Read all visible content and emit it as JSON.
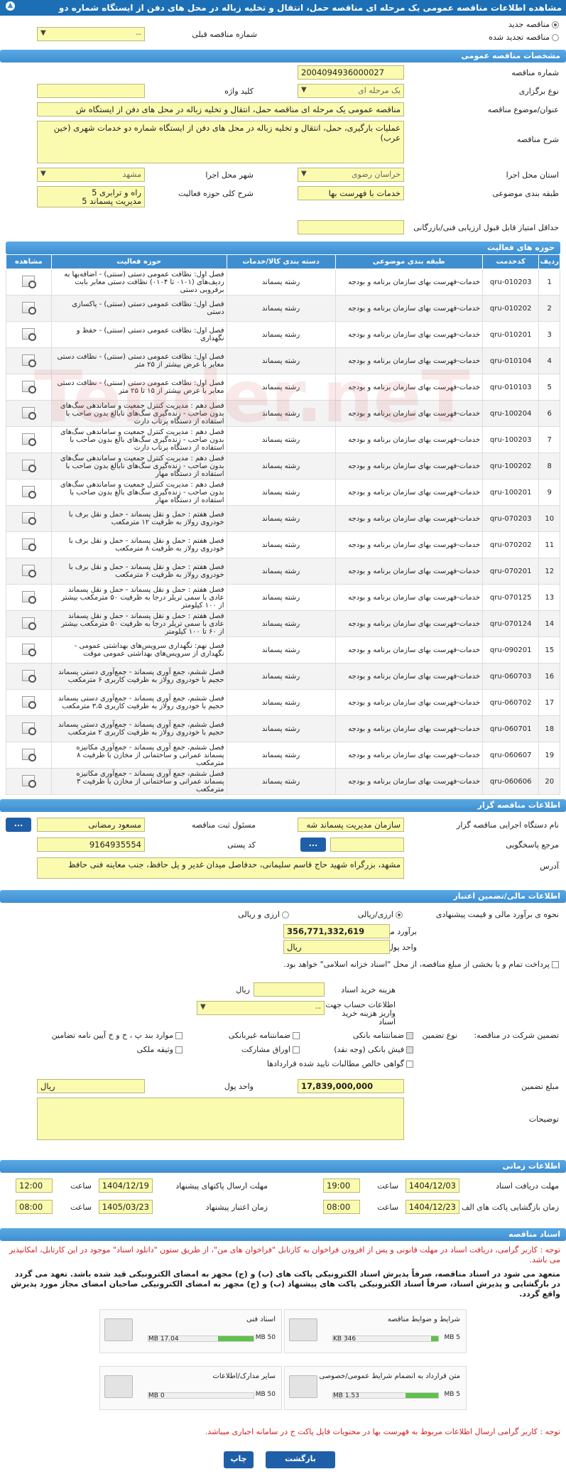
{
  "title": "مشاهده اطلاعات مناقصه عمومی یک مرحله ای مناقصه حمل، انتقال و تخلیه زباله در محل های دفن از ایستگاه شماره دو",
  "top": {
    "new_tender": "مناقصه جدید",
    "renewed_tender": "مناقصه تجدید شده",
    "prev_number_label": "شماره مناقصه قبلی",
    "prev_number_value": "--"
  },
  "general": {
    "header": "مشخصات مناقصه عمومی",
    "number_label": "شماره مناقصه",
    "number_value": "2004094936000027",
    "type_label": "نوع برگزاری",
    "type_value": "یک مرحله ای",
    "keyword_label": "کلید واژه",
    "keyword_value": "",
    "subject_label": "عنوان/موضوع مناقصه",
    "subject_value": "مناقصه عمومی یک مرحله ای مناقصه حمل، انتقال و تخلیه زباله در محل های دفن از ایستگاه ش",
    "desc_label": "شرح مناقصه",
    "desc_value": "عملیات بارگیری، حمل، انتقال و تخلیه زباله در محل های دفن از ایستگاه شماره دو خدمات شهری (خین عرب)",
    "province_label": "استان محل اجرا",
    "province_value": "خراسان رضوی",
    "city_label": "شهر محل اجرا",
    "city_value": "مشهد",
    "category_label": "طبقه بندی موضوعی",
    "category_value": "خدمات با فهرست بها",
    "scope_label": "شرح کلی حوزه فعالیت",
    "scope_lines": [
      "راه و ترابری      5",
      "مدیریت پسماند     5"
    ],
    "min_score_label": "حداقل امتیاز قابل قبول ارزیابی فنی/بازرگانی",
    "min_score_value": ""
  },
  "activity": {
    "header": "حوزه های فعالیت",
    "columns": [
      "ردیف",
      "کدخدمت",
      "طبقه بندی موضوعی",
      "دسته بندی کالا/خدمات",
      "حوزه فعالیت",
      "مشاهده"
    ],
    "rows": [
      {
        "n": "1",
        "code": "qru-010203",
        "cat": "خدمات-فهرست بهای سازمان برنامه و بودجه",
        "group": "رشته پسماند",
        "act": "فصل اول: نظافت عمومی دستی (سنتی) - اضافه‌بها به ردیف‌های (۰۱۰۱ تا ۰۱۰۴) نظافت دستی معابر بابت برفروبی دستی"
      },
      {
        "n": "2",
        "code": "qru-010202",
        "cat": "خدمات-فهرست بهای سازمان برنامه و بودجه",
        "group": "رشته پسماند",
        "act": "فصل اول: نظافت عمومی دستی (سنتی) - پاکسازی دستی"
      },
      {
        "n": "3",
        "code": "qru-010201",
        "cat": "خدمات-فهرست بهای سازمان برنامه و بودجه",
        "group": "رشته پسماند",
        "act": "فصل اول: نظافت عمومی دستی (سنتی) - حفظ و نگهداری"
      },
      {
        "n": "4",
        "code": "qru-010104",
        "cat": "خدمات-فهرست بهای سازمان برنامه و بودجه",
        "group": "رشته پسماند",
        "act": "فصل اول: نظافت عمومی دستی (سنتی) - نظافت دستی معابر با عرض بیشتر از ۲۵ متر"
      },
      {
        "n": "5",
        "code": "qru-010103",
        "cat": "خدمات-فهرست بهای سازمان برنامه و بودجه",
        "group": "رشته پسماند",
        "act": "فصل اول: نظافت عمومی دستی (سنتی) - نظافت دستی معابر با عرض بیشتر از ۱۵ تا ۲۵ متر"
      },
      {
        "n": "6",
        "code": "qru-100204",
        "cat": "خدمات-فهرست بهای سازمان برنامه و بودجه",
        "group": "رشته پسماند",
        "act": "فصل دهم : مدیریت کنترل جمعیت و ساماندهی سگ‌های بدون صاحب - زنده‌گیری سگ‌های نابالغ بدون صاحب با استفاده از دستگاه پرتاب دارت"
      },
      {
        "n": "7",
        "code": "qru-100203",
        "cat": "خدمات-فهرست بهای سازمان برنامه و بودجه",
        "group": "رشته پسماند",
        "act": "فصل دهم : مدیریت کنترل جمعیت و ساماندهی سگ‌های بدون صاحب - زنده‌گیری سگ‌های بالغ بدون صاحب با استفاده از دستگاه پرتاب دارت"
      },
      {
        "n": "8",
        "code": "qru-100202",
        "cat": "خدمات-فهرست بهای سازمان برنامه و بودجه",
        "group": "رشته پسماند",
        "act": "فصل دهم : مدیریت کنترل جمعیت و ساماندهی سگ‌های بدون صاحب - زنده‌گیری سگ‌های نابالغ بدون صاحب با استفاده از دستگاه مهار"
      },
      {
        "n": "9",
        "code": "qru-100201",
        "cat": "خدمات-فهرست بهای سازمان برنامه و بودجه",
        "group": "رشته پسماند",
        "act": "فصل دهم : مدیریت کنترل جمعیت و ساماندهی سگ‌های بدون صاحب - زنده‌گیری سگ‌های بالغ بدون صاحب با استفاده از دستگاه مهار"
      },
      {
        "n": "10",
        "code": "qru-070203",
        "cat": "خدمات-فهرست بهای سازمان برنامه و بودجه",
        "group": "رشته پسماند",
        "act": "فصل هفتم : حمل و نقل پسماند - حمل و نقل برف با خودروی رولاز به ظرفیت ۱۲ مترمکعب"
      },
      {
        "n": "11",
        "code": "qru-070202",
        "cat": "خدمات-فهرست بهای سازمان برنامه و بودجه",
        "group": "رشته پسماند",
        "act": "فصل هفتم : حمل و نقل پسماند - حمل و نقل برف با خودروی رولاز به ظرفیت ۸ مترمکعب"
      },
      {
        "n": "12",
        "code": "qru-070201",
        "cat": "خدمات-فهرست بهای سازمان برنامه و بودجه",
        "group": "رشته پسماند",
        "act": "فصل هفتم : حمل و نقل پسماند - حمل و نقل برف با خودروی رولاز به ظرفیت ۶ مترمکعب"
      },
      {
        "n": "13",
        "code": "qru-070125",
        "cat": "خدمات-فهرست بهای سازمان برنامه و بودجه",
        "group": "رشته پسماند",
        "act": "فصل هفتم : حمل و نقل پسماند - حمل و نقل پسماند عادی با سمی تریلر درجا به ظرفیت ۵۰ مترمکعب بیشتر از ۱۰۰ کیلومتر"
      },
      {
        "n": "14",
        "code": "qru-070124",
        "cat": "خدمات-فهرست بهای سازمان برنامه و بودجه",
        "group": "رشته پسماند",
        "act": "فصل هفتم : حمل و نقل پسماند - حمل و نقل پسماند عادی با سمی تریلر درجا به ظرفیت ۵۰ مترمکعب بیشتر از ۶۰ تا ۱۰۰ کیلومتر"
      },
      {
        "n": "15",
        "code": "qru-090201",
        "cat": "خدمات-فهرست بهای سازمان برنامه و بودجه",
        "group": "رشته پسماند",
        "act": "فصل نهم: نگهداری سرویس‌های بهداشتی عمومی - نگهداری از سرویس‌های بهداشتی عمومی موقت"
      },
      {
        "n": "16",
        "code": "qru-060703",
        "cat": "خدمات-فهرست بهای سازمان برنامه و بودجه",
        "group": "رشته پسماند",
        "act": "فصل ششم، جمع آوری پسماند - جمع‌آوری دستی پسماند حجیم با خودروی رولاز به ظرفیت کاربری ۶ مترمکعب"
      },
      {
        "n": "17",
        "code": "qru-060702",
        "cat": "خدمات-فهرست بهای سازمان برنامه و بودجه",
        "group": "رشته پسماند",
        "act": "فصل ششم، جمع آوری پسماند - جمع‌آوری دستی پسماند حجیم با خودروی رولاز به ظرفیت کاربری ۳،۵ مترمکعب"
      },
      {
        "n": "18",
        "code": "qru-060701",
        "cat": "خدمات-فهرست بهای سازمان برنامه و بودجه",
        "group": "رشته پسماند",
        "act": "فصل ششم، جمع آوری پسماند - جمع‌آوری دستی پسماند حجیم با خودروی رولاز به ظرفیت کاربری ۲ مترمکعب"
      },
      {
        "n": "19",
        "code": "qru-060607",
        "cat": "خدمات-فهرست بهای سازمان برنامه و بودجه",
        "group": "رشته پسماند",
        "act": "فصل ششم، جمع آوری پسماند - جمع‌آوری مکانیزه پسماند عمرانی و ساختمانی از مخازن با ظرفیت ۸ مترمکعب"
      },
      {
        "n": "20",
        "code": "qru-060606",
        "cat": "خدمات-فهرست بهای سازمان برنامه و بودجه",
        "group": "رشته پسماند",
        "act": "فصل ششم، جمع آوری پسماند - جمع‌آوری مکانیزه پسماند عمرانی و ساختمانی از مخازن با ظرفیت ۳ مترمکعب"
      }
    ]
  },
  "organizer": {
    "header": "اطلاعات مناقصه گزار",
    "org_label": "نام دستگاه اجرایی مناقصه گزار",
    "org_value": "سازمان مدیریت پسماند شه",
    "responsible_label": "مسئول ثبت مناقصه",
    "responsible_value": "مسعود رمضانی",
    "ref_label": "مرجع پاسخگویی",
    "ref_value": "",
    "postal_label": "کد پستی",
    "postal_value": "9164935554",
    "address_label": "آدرس",
    "address_value": "مشهد، بزرگراه شهید حاج قاسم سلیمانی، حدفاصل میدان غدیر و پل حافظ، جنب معاینه فنی حافظ",
    "more": "..."
  },
  "finance": {
    "header": "اطلاعات مالی/تضمین اعتبار",
    "method_label": "نحوه ی برآورد مالی و قیمت پیشنهادی",
    "opt_rial": "ارزی/ریالی",
    "opt_fx": "ارزی و ریالی",
    "estimate_label": "برآورد مالی",
    "estimate_value": "356,771,332,619",
    "unit_label": "واحد پول",
    "unit_value": "ریال",
    "treasury_text": "پرداخت تمام و یا بخشی از مبلغ مناقصه، از محل \"اسناد خزانه اسلامی\" خواهد بود.",
    "doc_cost_label": "هزینه خرید اسناد",
    "doc_cost_unit": "ریال",
    "account_label": "اطلاعات حساب جهت واریز هزینه خرید اسناد",
    "account_value": "--",
    "participation_label": "تضمین شرکت در مناقصه:",
    "guarantee_type_label": "نوع تضمین",
    "g_bank": "ضمانتنامه بانکی",
    "g_nonbank": "ضمانتنامه غیربانکی",
    "g_clause": "موارد بند پ ، ح و خ آیین نامه تضامین",
    "g_cheque": "فیش بانکی (وجه نقد)",
    "g_bonds": "اوراق مشارکت",
    "g_property": "وثیقه ملکی",
    "g_claims": "گواهی خالص مطالبات تایید شده قراردادها",
    "amount_label": "مبلغ تضمین",
    "amount_value": "17,839,000,000",
    "amount_unit_label": "واحد پول",
    "amount_unit_value": "ریال",
    "notes_label": "توضیحات",
    "notes_value": ""
  },
  "timing": {
    "header": "اطلاعات زمانی",
    "receive_label": "مهلت دریافت اسناد",
    "receive_date": "1404/12/03",
    "receive_time_label": "ساعت",
    "receive_time": "19:00",
    "send_label": "مهلت ارسال پاکتهای پیشنهاد",
    "send_date": "1404/12/19",
    "send_time_label": "ساعت",
    "send_time": "12:00",
    "open_label": "زمان بازگشایی پاکت های الف",
    "open_date": "1404/12/23",
    "open_time_label": "ساعت",
    "open_time": "08:00",
    "valid_label": "زمان اعتبار پیشنهاد",
    "valid_date": "1405/03/23",
    "valid_time_label": "ساعت",
    "valid_time": "08:00"
  },
  "documents": {
    "header": "اسناد مناقصه",
    "note1": "توجه : کاربر گرامی، دریافت اسناد در مهلت قانونی و پس از افزودن فراخوان به کارتابل \"فراخوان های من\"، از طریق ستون \"دانلود اسناد\" موجود در این کارتابل، امکانپذیر می باشد.",
    "note2": "متعهد می شود در اسناد مناقصه، صرفاً پذیرش اسناد الکترونیکی پاکت های (ب) و (ج) مجهز به امضای الکترونیکی قید شده باشد. تعهد می گردد در بارگشایی و پذیرش اسناد، صرفاً اسناد الکترونیکی پاکت های پیشنهاد (ب) و (ج) مجهز به امضای الکترونیکی صاحبان امضای مجاز مورد پذیرش واقع گردد.",
    "cards": [
      {
        "title": "شرایط و ضوابط مناقصه",
        "max": "5 MB",
        "used": "346 KB",
        "pct": 7
      },
      {
        "title": "اسناد فنی",
        "max": "50 MB",
        "used": "17.04 MB",
        "pct": 34
      },
      {
        "title": "متن قرارداد به انضمام شرایط عمومی/خصوصی",
        "max": "5 MB",
        "used": "1.53 MB",
        "pct": 31
      },
      {
        "title": "سایر مدارک/اطلاعات",
        "max": "50 MB",
        "used": "0 MB",
        "pct": 0
      }
    ],
    "note3": "توجه : کاربر گرامی ارسال اطلاعات مربوط به فهرست بها در محتویات فایل پاکت ج در سامانه اجباری میباشد."
  },
  "buttons": {
    "print": "چاپ",
    "back": "بازگشت"
  },
  "watermark": "Tender.neT"
}
